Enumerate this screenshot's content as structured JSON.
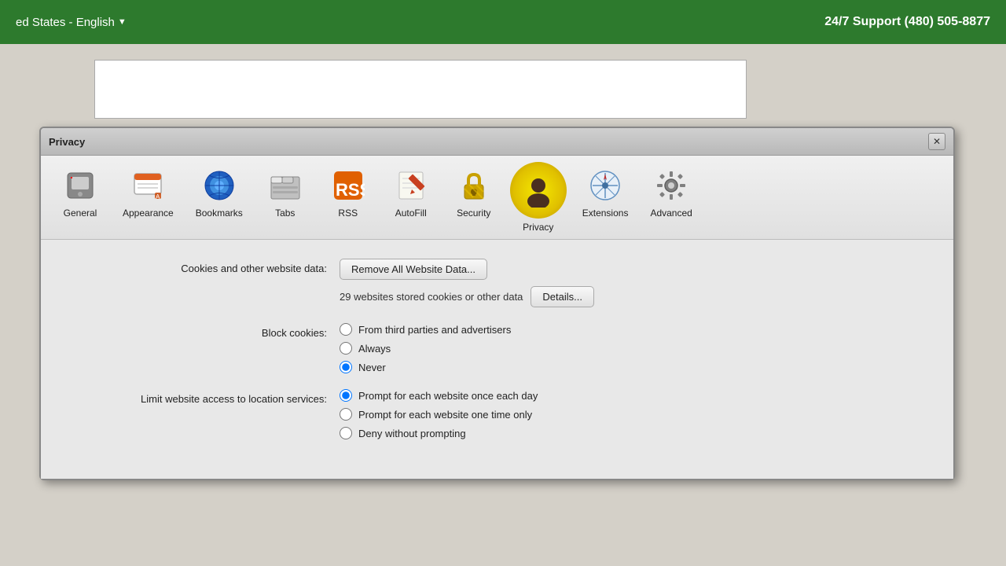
{
  "topbar": {
    "region": "ed States - English",
    "chevron": "▼",
    "support": "24/7 Support (480) 505-8877"
  },
  "dialog": {
    "title": "Privacy",
    "close_label": "✕"
  },
  "toolbar": {
    "items": [
      {
        "id": "general",
        "label": "General"
      },
      {
        "id": "appearance",
        "label": "Appearance"
      },
      {
        "id": "bookmarks",
        "label": "Bookmarks"
      },
      {
        "id": "tabs",
        "label": "Tabs"
      },
      {
        "id": "rss",
        "label": "RSS"
      },
      {
        "id": "autofill",
        "label": "AutoFill"
      },
      {
        "id": "security",
        "label": "Security"
      },
      {
        "id": "privacy",
        "label": "Privacy"
      },
      {
        "id": "extensions",
        "label": "Extensions"
      },
      {
        "id": "advanced",
        "label": "Advanced"
      }
    ]
  },
  "cookies_section": {
    "label": "Cookies and other website data:",
    "remove_button": "Remove All Website Data...",
    "info_text": "29 websites stored cookies or other data",
    "details_button": "Details..."
  },
  "block_cookies": {
    "label": "Block cookies:",
    "options": [
      {
        "id": "third-party",
        "label": "From third parties and advertisers",
        "checked": false
      },
      {
        "id": "always",
        "label": "Always",
        "checked": false
      },
      {
        "id": "never",
        "label": "Never",
        "checked": true
      }
    ]
  },
  "location_services": {
    "label": "Limit website access to location services:",
    "options": [
      {
        "id": "prompt-daily",
        "label": "Prompt for each website once each day",
        "checked": true
      },
      {
        "id": "prompt-once",
        "label": "Prompt for each website one time only",
        "checked": false
      },
      {
        "id": "deny",
        "label": "Deny without prompting",
        "checked": false
      }
    ]
  }
}
